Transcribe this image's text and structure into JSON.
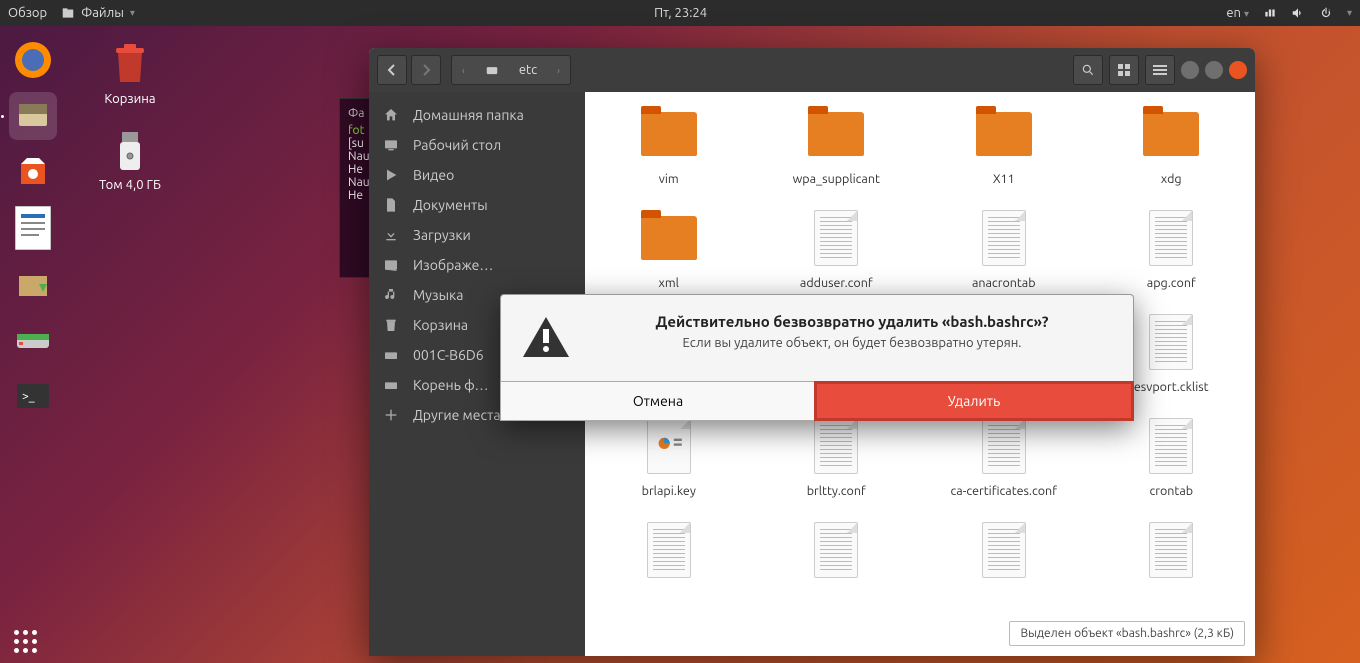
{
  "topbar": {
    "overview": "Обзор",
    "files": "Файлы",
    "datetime": "Пт, 23:24",
    "lang": "en"
  },
  "desktop": {
    "trash": "Корзина",
    "usb": "Том 4,0 ГБ"
  },
  "terminal": {
    "title": "Фа",
    "lines": [
      "fot",
      "[su",
      "Nau",
      "Не",
      "Nau",
      "Не"
    ]
  },
  "nautilus": {
    "path": "etc",
    "sidebar": [
      {
        "label": "Домашняя папка",
        "icon": "home"
      },
      {
        "label": "Рабочий стол",
        "icon": "desktop"
      },
      {
        "label": "Видео",
        "icon": "video"
      },
      {
        "label": "Документы",
        "icon": "documents"
      },
      {
        "label": "Загрузки",
        "icon": "downloads"
      },
      {
        "label": "Изображе…",
        "icon": "pictures"
      },
      {
        "label": "Музыка",
        "icon": "music"
      },
      {
        "label": "Корзина",
        "icon": "trash"
      },
      {
        "label": "001C-B6D6",
        "icon": "drive"
      },
      {
        "label": "Корень ф…",
        "icon": "root"
      },
      {
        "label": "Другие места",
        "icon": "other"
      }
    ],
    "rows": [
      [
        {
          "n": "vim",
          "t": "folder"
        },
        {
          "n": "wpa_supplicant",
          "t": "folder"
        },
        {
          "n": "X11",
          "t": "folder"
        },
        {
          "n": "xdg",
          "t": "folder"
        }
      ],
      [
        {
          "n": "xml",
          "t": "folder"
        },
        {
          "n": "adduser.conf",
          "t": "doc"
        },
        {
          "n": "anacrontab",
          "t": "doc"
        },
        {
          "n": "apg.conf",
          "t": "doc"
        }
      ],
      [
        {
          "n": "",
          "t": "doc"
        },
        {
          "n": "",
          "t": "doc"
        },
        {
          "n": "",
          "t": "doc"
        },
        {
          "n": "esvport.cklist",
          "t": "doc"
        }
      ],
      [
        {
          "n": "brlapi.key",
          "t": "slide"
        },
        {
          "n": "brltty.conf",
          "t": "doc"
        },
        {
          "n": "ca-certificates.conf",
          "t": "doc"
        },
        {
          "n": "crontab",
          "t": "doc"
        }
      ],
      [
        {
          "n": "",
          "t": "doc"
        },
        {
          "n": "",
          "t": "doc"
        },
        {
          "n": "",
          "t": "doc"
        },
        {
          "n": "",
          "t": "doc"
        }
      ]
    ],
    "status": "Выделен объект «bash.bashrc» (2,3 кБ)"
  },
  "dialog": {
    "title": "Действительно безвозвратно удалить «bash.bashrc»?",
    "message": "Если вы удалите объект, он будет безвозвратно утерян.",
    "cancel": "Отмена",
    "delete": "Удалить"
  }
}
